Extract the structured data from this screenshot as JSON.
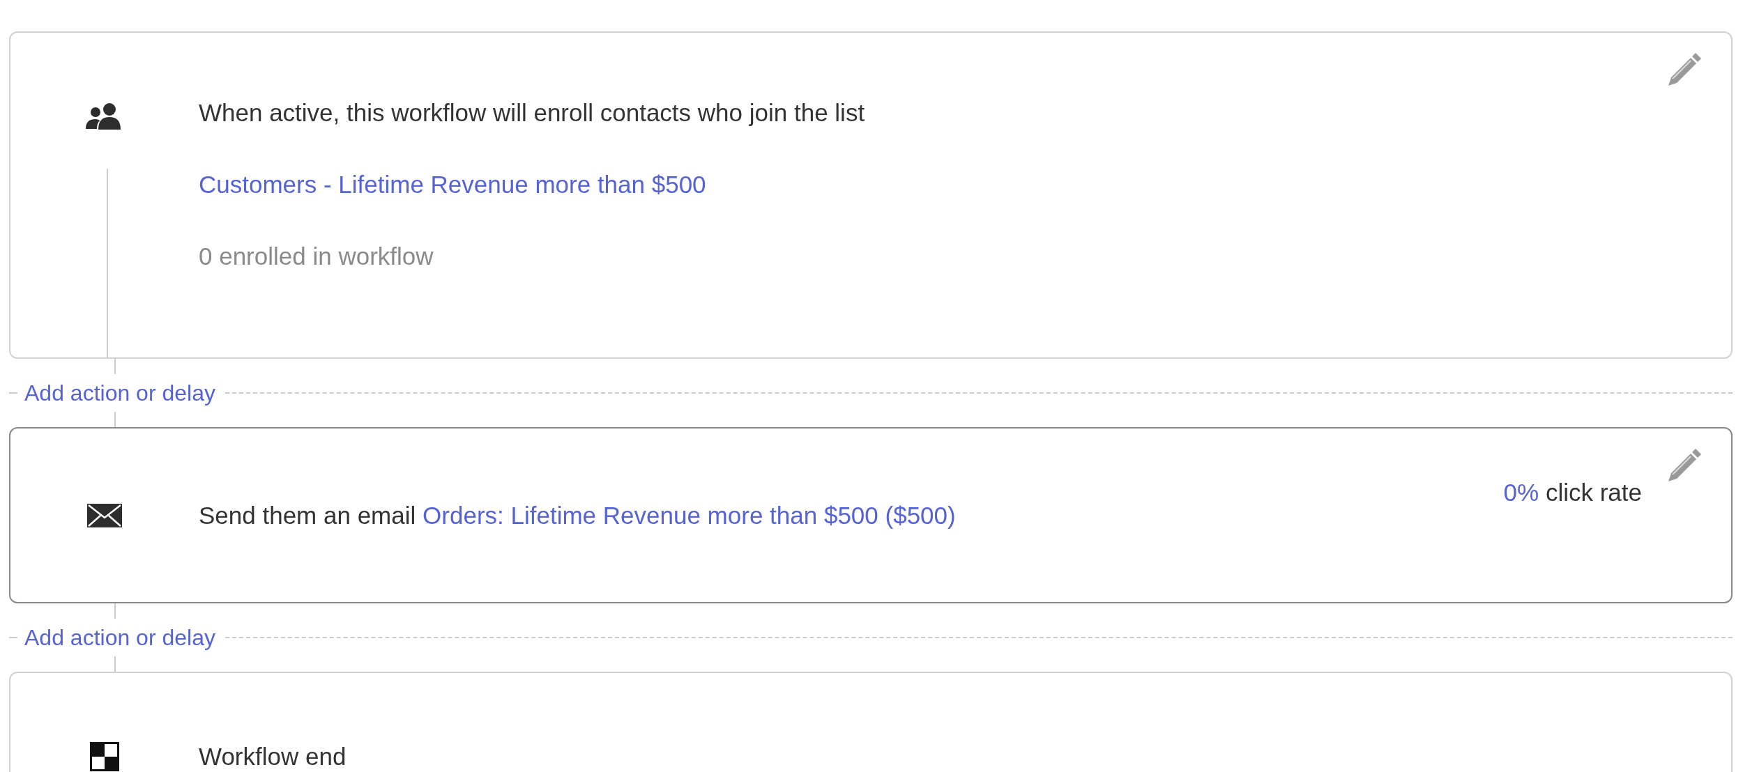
{
  "steps": [
    {
      "kind": "trigger",
      "highlighted": false,
      "editable": true,
      "text": "When active, this workflow will enroll contacts who join the list",
      "link": "Customers - Lifetime Revenue more than $500",
      "note": "0 enrolled in workflow",
      "add_action": "Add action or delay"
    },
    {
      "kind": "email",
      "highlighted": true,
      "editable": true,
      "text": "Send them an email",
      "link": "Orders: Lifetime Revenue more than $500 ($500)",
      "stat_value": "0%",
      "stat_label": "click rate",
      "add_action": "Add action or delay"
    },
    {
      "kind": "end",
      "highlighted": false,
      "editable": false,
      "text": "Workflow end"
    }
  ]
}
